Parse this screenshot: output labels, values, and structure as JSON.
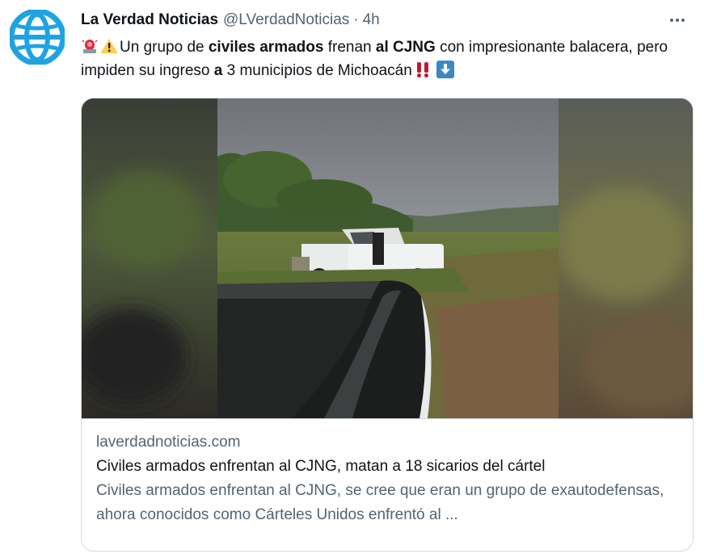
{
  "tweet": {
    "display_name": "La Verdad Noticias",
    "handle": "@LVerdadNoticias",
    "separator": "·",
    "time": "4h",
    "avatar_icon": "globe-logo-icon",
    "text": {
      "part1": "Un grupo de ",
      "bold1": "civiles armados",
      "part2": " frenan ",
      "bold2": "al CJNG",
      "part3": " con impresionante balacera, pero impiden su ingreso ",
      "bold3": "a",
      "part4": " 3 municipios de Michoacán"
    },
    "emojis": [
      "police-light-icon",
      "warning-icon",
      "double-exclamation-icon",
      "down-arrow-icon"
    ]
  },
  "card": {
    "domain": "laverdadnoticias.com",
    "title": "Civiles armados enfrentan al CJNG, matan a 18 sicarios del cártel",
    "description": "Civiles armados enfrentan al CJNG, se cree que eran un grupo de exautodefensas, ahora conocidos como Cárteles Unidos enfrentó al ..."
  },
  "colors": {
    "brand_blue": "#1d9bf0",
    "text_primary": "#0f1419",
    "text_secondary": "#536471",
    "border": "#cfd9de"
  }
}
